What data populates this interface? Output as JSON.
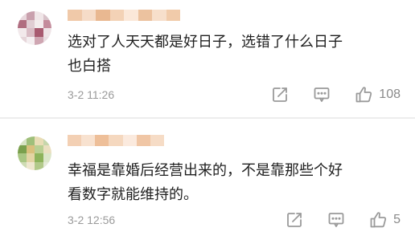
{
  "theme": {
    "icon_color": "#9a9a9a",
    "text_color": "#1f1f1f",
    "meta_color": "#9a9a9a"
  },
  "comments": [
    {
      "username_blurred": true,
      "avatar_colors": [
        "#e8d7dc",
        "#c9a0ad",
        "#f0e6e8",
        "#d8c2c9",
        "#b06d80",
        "#e0cdd3",
        "#f3eced",
        "#c48c9c",
        "#f2e9eb",
        "#d9bcc5",
        "#a85a70",
        "#efe4e7",
        "#e6d6da",
        "#f4eef0",
        "#cfa6b2",
        "#e9dde1"
      ],
      "username_colors": [
        "#f0c9a9",
        "#f6dcc8",
        "#e9b891",
        "#f3d2b6",
        "#fbe8d9",
        "#ecc29f",
        "#f7dfcb",
        "#f1cbaa"
      ],
      "lines": [
        "选对了人天天都是好日子，选错了什么日子",
        "也白搭"
      ],
      "time": "3-2 11:26",
      "share_icon": "share-icon",
      "comment_icon": "comment-icon",
      "like_icon": "thumbs-up-icon",
      "likes": "108"
    },
    {
      "username_blurred": true,
      "avatar_colors": [
        "#d7e3c4",
        "#9fbf7a",
        "#e9ddb6",
        "#c6d6ab",
        "#7aa04d",
        "#d9c07d",
        "#b9cf93",
        "#eadfc0",
        "#a9c683",
        "#e3d4a4",
        "#8db35c",
        "#dbe6c9",
        "#cfdcb4",
        "#efe7cf",
        "#b2c98a",
        "#e5ead8"
      ],
      "username_colors": [
        "#f3d0b4",
        "#f8e2d0",
        "#eebf99",
        "#f5d8bf",
        "#fbeade",
        "#f0c6a5",
        "#f6dcc6"
      ],
      "lines": [
        "幸福是靠婚后经营出来的，不是靠那些个好",
        "看数字就能维持的。"
      ],
      "time": "3-2 12:56",
      "share_icon": "share-icon",
      "comment_icon": "comment-icon",
      "like_icon": "thumbs-up-icon",
      "likes": "5"
    }
  ]
}
